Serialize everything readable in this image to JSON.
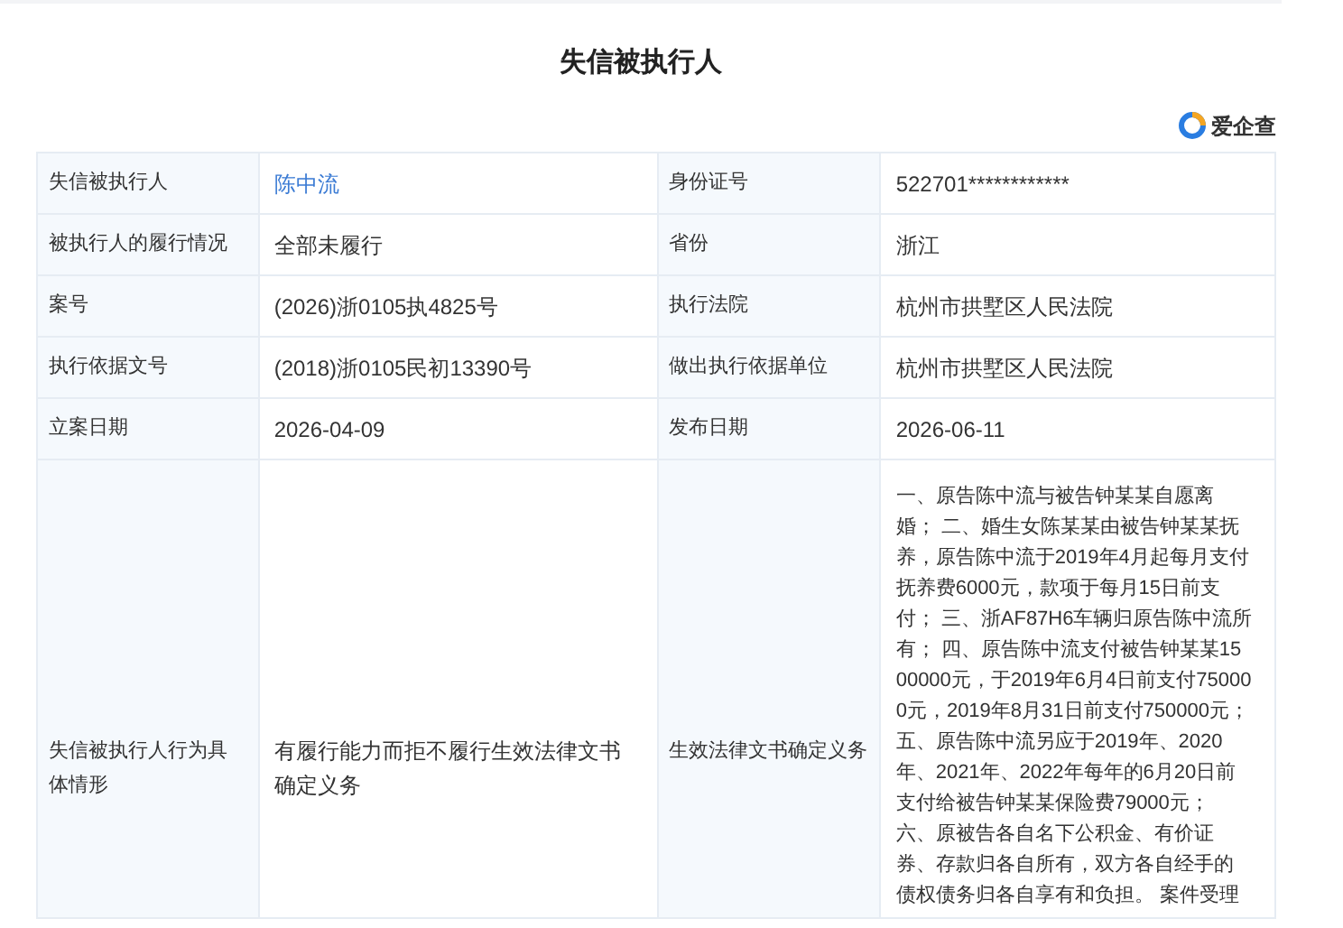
{
  "title": "失信被执行人",
  "brand": "爱企查",
  "rows": [
    {
      "cells": [
        {
          "label": "失信被执行人",
          "value": "陈中流",
          "kind": "link"
        },
        {
          "label": "身份证号",
          "value": "522701************",
          "kind": "text"
        }
      ]
    },
    {
      "cells": [
        {
          "label": "被执行人的履行情况",
          "value": "全部未履行",
          "kind": "text"
        },
        {
          "label": "省份",
          "value": "浙江",
          "kind": "text"
        }
      ]
    },
    {
      "cells": [
        {
          "label": "案号",
          "value": "(2026)浙0105执4825号",
          "kind": "text"
        },
        {
          "label": "执行法院",
          "value": "杭州市拱墅区人民法院",
          "kind": "text"
        }
      ]
    },
    {
      "cells": [
        {
          "label": "执行依据文号",
          "value": "(2018)浙0105民初13390号",
          "kind": "text"
        },
        {
          "label": "做出执行依据单位",
          "value": "杭州市拱墅区人民法院",
          "kind": "text"
        }
      ]
    },
    {
      "cells": [
        {
          "label": "立案日期",
          "value": "2026-04-09",
          "kind": "text"
        },
        {
          "label": "发布日期",
          "value": "2026-06-11",
          "kind": "text"
        }
      ]
    }
  ],
  "detail_row": {
    "cells": [
      {
        "label": "失信被执行人行为具体情形",
        "value": "有履行能力而拒不履行生效法律文书确定义务",
        "kind": "text"
      },
      {
        "label": "生效法律文书确定义务",
        "kind": "long",
        "lines": [
          "一、原告陈中流与被告钟某某自愿离",
          "婚； 二、婚生女陈某某由被告钟某某抚",
          "养，原告陈中流于2019年4月起每月支付",
          "抚养费6000元，款项于每月15日前支",
          "付； 三、浙AF87H6车辆归原告陈中流所",
          "有； 四、原告陈中流支付被告钟某某15",
          "00000元，于2019年6月4日前支付75000",
          "0元，2019年8月31日前支付750000元；",
          "五、原告陈中流另应于2019年、2020",
          "年、2021年、2022年每年的6月20日前",
          "支付给被告钟某某保险费79000元；",
          "六、原被告各自名下公积金、有价证",
          "券、存款归各自所有，双方各自经手的",
          "债权债务归各自享有和负担。 案件受理"
        ]
      }
    ]
  }
}
